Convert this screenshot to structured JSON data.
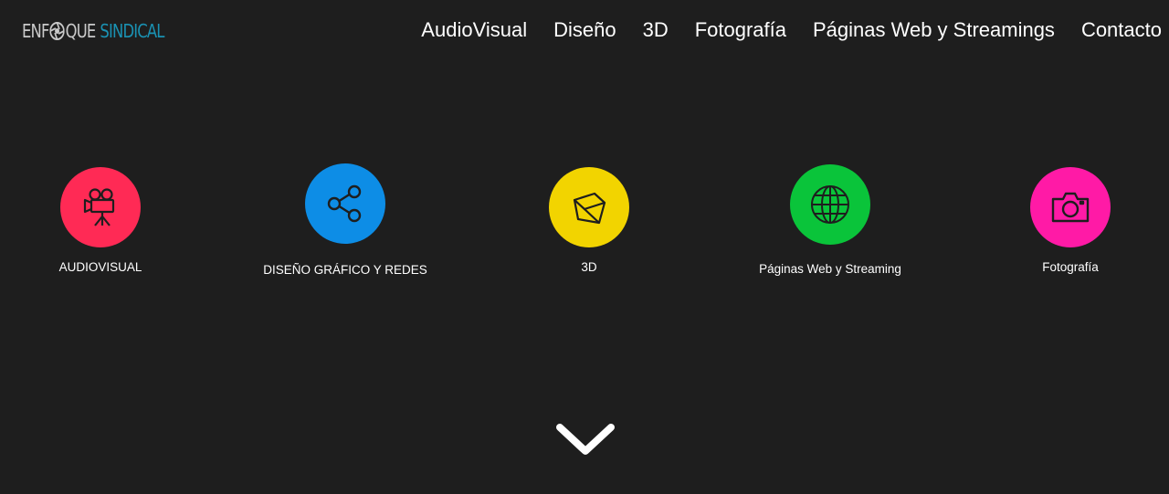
{
  "header": {
    "logo": {
      "word1": "ENF",
      "word1_end": "QUE",
      "word2": "SINDICAL"
    },
    "nav": [
      {
        "label": "AudioVisual"
      },
      {
        "label": "Diseño"
      },
      {
        "label": "3D"
      },
      {
        "label": "Fotografía"
      },
      {
        "label": "Páginas Web y Streamings"
      },
      {
        "label": "Contacto"
      }
    ]
  },
  "services": [
    {
      "label": "AUDIOVISUAL",
      "icon": "film-camera-icon",
      "color": "#ff2a55"
    },
    {
      "label": "DISEÑO GRÁFICO Y REDES",
      "icon": "share-icon",
      "color": "#0d8de6"
    },
    {
      "label": "3D",
      "icon": "cube-icon",
      "color": "#f2d400"
    },
    {
      "label": "Páginas Web y Streaming",
      "icon": "globe-icon",
      "color": "#0ac43a"
    },
    {
      "label": "Fotografía",
      "icon": "photo-camera-icon",
      "color": "#ff1aa6"
    }
  ],
  "scroll_indicator": {
    "icon": "chevron-down-icon"
  },
  "colors": {
    "background": "#1e1e1e",
    "text": "#ffffff",
    "logo_accent": "#1a92b3"
  }
}
